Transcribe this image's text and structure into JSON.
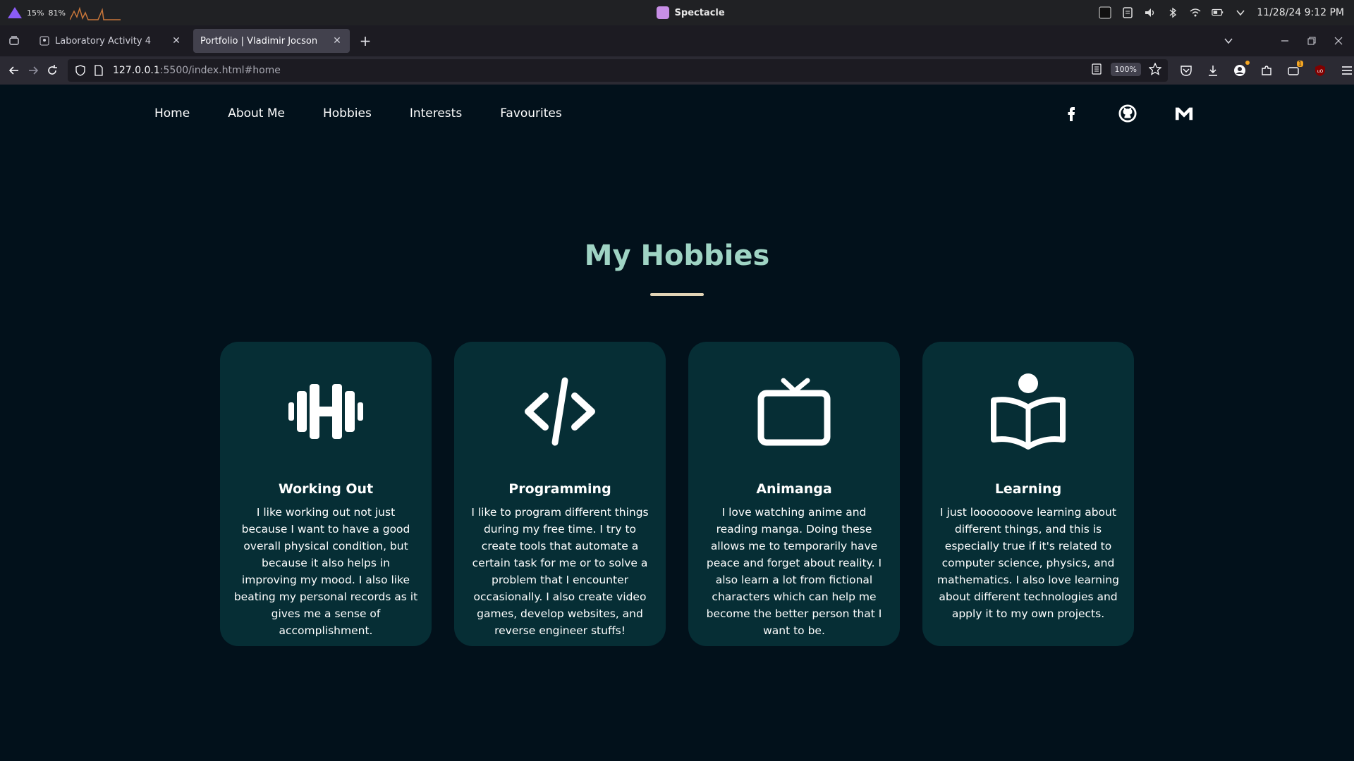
{
  "system": {
    "cpu": "15%",
    "mem": "81%",
    "app_title": "Spectacle",
    "clock": "11/28/24 9:12 PM",
    "battery_label": "42%"
  },
  "browser": {
    "tabs": [
      {
        "title": "Laboratory Activity 4",
        "active": false
      },
      {
        "title": "Portfolio | Vladimir Jocson",
        "active": true
      }
    ],
    "url_host": "127.0.0.1",
    "url_rest": ":5500/index.html#home",
    "zoom": "100%",
    "addon_badge": "1"
  },
  "site": {
    "nav": [
      "Home",
      "About Me",
      "Hobbies",
      "Interests",
      "Favourites"
    ],
    "socials": [
      "facebook-icon",
      "github-icon",
      "gmail-icon"
    ],
    "section_title": "My Hobbies",
    "accent": "#9fd4c4",
    "card_bg": "#062e35",
    "cards": [
      {
        "icon": "dumbbell-icon",
        "title": "Working Out",
        "text": "I like working out not just because I want to have a good overall physical condition, but because it also helps in improving my mood. I also like beating my personal records as it gives me a sense of accomplishment."
      },
      {
        "icon": "code-icon",
        "title": "Programming",
        "text": "I like to program different things during my free time. I try to create tools that automate a certain task for me or to solve a problem that I encounter occasionally. I also create video games, develop websites, and reverse engineer stuffs!"
      },
      {
        "icon": "tv-icon",
        "title": "Animanga",
        "text": "I love watching anime and reading manga. Doing these allows me to temporarily have peace and forget about reality. I also learn a lot from fictional characters which can help me become the better person that I want to be."
      },
      {
        "icon": "reader-icon",
        "title": "Learning",
        "text": "I just looooooove learning about different things, and this is especially true if it's related to computer science, physics, and mathematics. I also love learning about different technologies and apply it to my own projects."
      }
    ]
  }
}
